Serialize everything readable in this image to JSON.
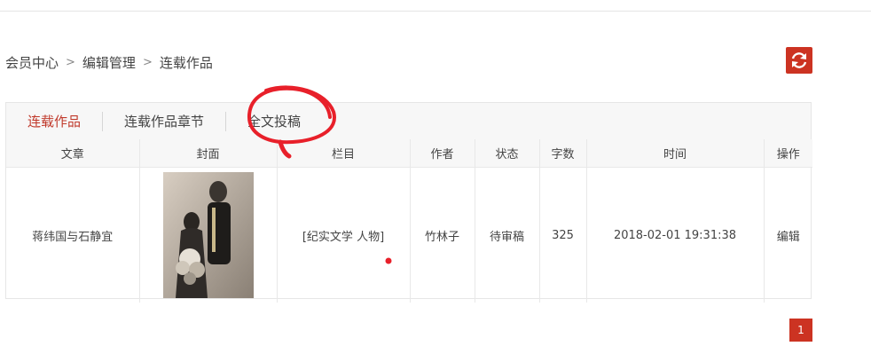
{
  "breadcrumb": {
    "items": [
      "会员中心",
      "编辑管理",
      "连载作品"
    ],
    "separator": ">"
  },
  "refresh": {
    "icon": "refresh-icon",
    "color": "#cc3322"
  },
  "tabs": [
    {
      "label": "连载作品",
      "active": true
    },
    {
      "label": "连载作品章节",
      "active": false
    },
    {
      "label": "全文投稿",
      "active": false
    }
  ],
  "table": {
    "headers": [
      "文章",
      "封面",
      "栏目",
      "作者",
      "状态",
      "字数",
      "时间",
      "操作"
    ],
    "rows": [
      {
        "title": "蒋纬国与石静宜",
        "cover": "wedding-photo",
        "category": "[纪实文学 人物]",
        "author": "竹林子",
        "status": "待审稿",
        "words": "325",
        "time": "2018-02-01 19:31:38",
        "action": "编辑"
      }
    ]
  },
  "pagination": {
    "current": "1"
  },
  "colors": {
    "accent": "#cc3322",
    "annotation": "#e8202a"
  }
}
